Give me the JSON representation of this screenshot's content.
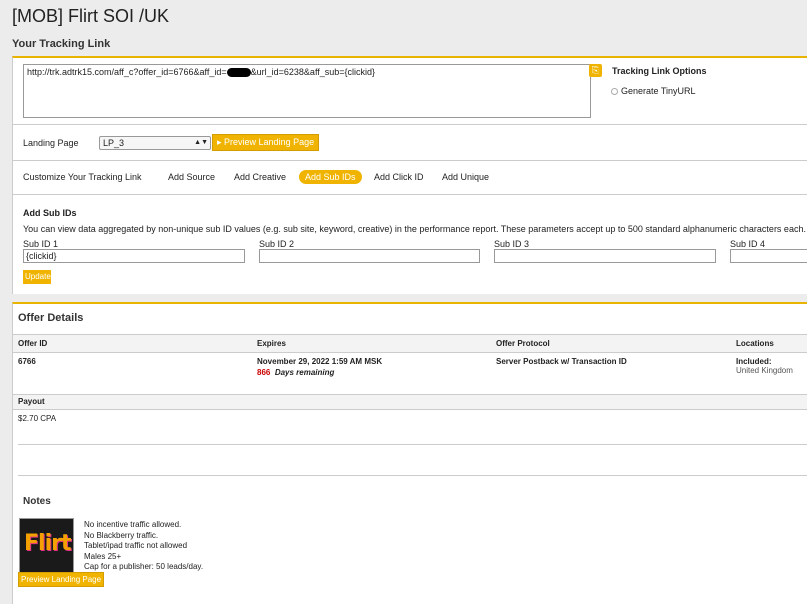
{
  "page": {
    "title": "[MOB] Flirt SOI /UK"
  },
  "tracking": {
    "section_title": "Your Tracking Link",
    "url_prefix": "http://trk.adtrk15.com/aff_c?offer_id=6766&aff_id=",
    "url_suffix": "&url_id=6238&aff_sub={clickid}",
    "copy_icon": "copy-icon",
    "options_title": "Tracking Link Options",
    "tinyurl_label": "Generate TinyURL",
    "landing_label": "Landing Page",
    "landing_value": "LP_3",
    "preview_button": "Preview Landing Page",
    "customize_label": "Customize Your Tracking Link",
    "customize_links": [
      "Add Source",
      "Add Creative",
      "Add Sub IDs",
      "Add Click ID",
      "Add Unique"
    ],
    "active_customize": "Add Sub IDs",
    "sub_title": "Add Sub IDs",
    "sub_description": "You can view data aggregated by non-unique sub ID values (e.g. sub site, keyword, creative) in the performance report. These parameters accept up to 500 standard alphanumeric characters each.",
    "sub_labels": [
      "Sub ID 1",
      "Sub ID 2",
      "Sub ID 3",
      "Sub ID 4"
    ],
    "sub_values": [
      "{clickid}",
      "",
      "",
      ""
    ],
    "update_button": "Update"
  },
  "offer": {
    "section_title": "Offer Details",
    "headers": [
      "Offer ID",
      "Expires",
      "Offer Protocol",
      "Locations"
    ],
    "offer_id": "6766",
    "expires": "November 29, 2022 1:59 AM MSK",
    "days_count": "866",
    "days_label": "Days remaining",
    "protocol": "Server Postback w/ Transaction ID",
    "locations_label": "Included:",
    "locations_value": "United Kingdom",
    "payout_header": "Payout",
    "payout_value": "$2.70  CPA"
  },
  "notes": {
    "title": "Notes",
    "logo_text": "Flirt",
    "lines": [
      "No incentive traffic allowed.",
      "No Blackberry traffic.",
      "Tablet/ipad traffic not allowed",
      "Males 25+",
      "Cap for a publisher: 50 leads/day."
    ],
    "preview_button": "Preview Landing Page"
  },
  "colors": {
    "accent": "#f0b400",
    "background": "#ececec",
    "days_red": "#cc0000"
  }
}
